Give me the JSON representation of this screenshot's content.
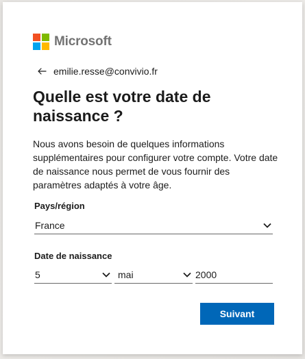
{
  "brand": {
    "name": "Microsoft",
    "logo_colors": [
      "#f25022",
      "#7fba00",
      "#00a4ef",
      "#ffb900"
    ],
    "logo_icon": "microsoft-logo"
  },
  "identity": {
    "back_icon": "arrow-left-icon",
    "email": "emilie.resse@convivio.fr"
  },
  "title": "Quelle est votre date de naissance ?",
  "description": "Nous avons besoin de quelques informations supplémentaires pour configurer votre compte. Votre date de naissance nous permet de vous fournir des paramètres adaptés à votre âge.",
  "country": {
    "label": "Pays/région",
    "value": "France"
  },
  "birthdate": {
    "label": "Date de naissance",
    "day": "5",
    "month": "mai",
    "year": "2000"
  },
  "actions": {
    "next_label": "Suivant"
  },
  "colors": {
    "accent": "#0067b8",
    "text": "#1b1b1b",
    "brand_text": "#737373"
  }
}
